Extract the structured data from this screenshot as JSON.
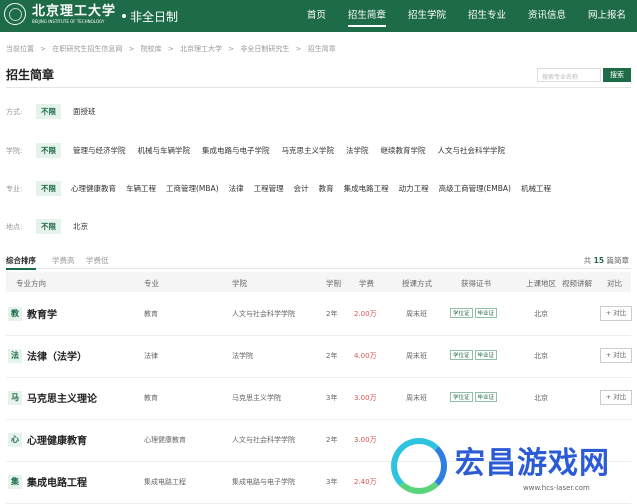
{
  "header": {
    "logo_cn": "北京理工大学",
    "logo_en": "BEIJING INSTITUTE OF TECHNOLOGY",
    "sub_title": "非全日制",
    "nav": [
      "首页",
      "招生简章",
      "招生学院",
      "招生专业",
      "资讯信息",
      "网上报名"
    ],
    "active_nav": "招生简章",
    "brand_color": "#1e6b47"
  },
  "breadcrumb": [
    "当前位置",
    ">",
    "在职研究生招生信息网",
    ">",
    "院校库",
    ">",
    "北京理工大学",
    ">",
    "非全日制研究生",
    ">",
    "招生简章"
  ],
  "page_title": "招生简章",
  "search": {
    "placeholder": "搜索专业名称",
    "button": "搜索"
  },
  "filters": {
    "mode": {
      "label": "方式:",
      "options": [
        "不限",
        "面授班"
      ]
    },
    "college": {
      "label": "学院:",
      "options": [
        "不限",
        "管理与经济学院",
        "机械与车辆学院",
        "集成电路与电子学院",
        "马克思主义学院",
        "法学院",
        "继续教育学院",
        "人文与社会科学学院"
      ]
    },
    "major": {
      "label": "专业:",
      "options": [
        "不限",
        "心理健康教育",
        "车辆工程",
        "工商管理(MBA)",
        "法律",
        "工程管理",
        "会计",
        "教育",
        "集成电路工程",
        "动力工程",
        "高级工商管理(EMBA)",
        "机械工程"
      ]
    },
    "location": {
      "label": "地点:",
      "options": [
        "不限",
        "北京"
      ]
    }
  },
  "sort": {
    "options": [
      "综合排序",
      "学费高",
      "学费低"
    ],
    "total_prefix": "共",
    "total": "15",
    "total_suffix": "篇简章"
  },
  "table": {
    "headers": [
      "专业方向",
      "专业",
      "学院",
      "学制",
      "学费",
      "授课方式",
      "获得证书",
      "上课地区",
      "视频讲解",
      "对比"
    ],
    "rows": [
      {
        "char": "教",
        "name": "教育学",
        "major": "教育",
        "college": "人文与社会科学学院",
        "years": "2年",
        "fee": "2.00万",
        "mode": "周末班",
        "certs": [
          "学位证",
          "毕业证"
        ],
        "location": "北京",
        "compare": "+ 对比"
      },
      {
        "char": "法",
        "name": "法律（法学）",
        "major": "法律",
        "college": "法学院",
        "years": "2年",
        "fee": "4.00万",
        "mode": "周末班",
        "certs": [
          "学位证",
          "毕业证"
        ],
        "location": "北京",
        "compare": "+ 对比"
      },
      {
        "char": "马",
        "name": "马克思主义理论",
        "major": "教育",
        "college": "马克思主义学院",
        "years": "3年",
        "fee": "3.00万",
        "mode": "周末班",
        "certs": [
          "学位证",
          "毕业证"
        ],
        "location": "北京",
        "compare": "+ 对比"
      },
      {
        "char": "心",
        "name": "心理健康教育",
        "major": "心理健康教育",
        "college": "人文与社会科学学院",
        "years": "2年",
        "fee": "3.00万",
        "mode": "",
        "certs": [],
        "location": "",
        "compare": ""
      },
      {
        "char": "集",
        "name": "集成电路工程",
        "major": "集成电路工程",
        "college": "集成电路与电子学院",
        "years": "3年",
        "fee": "2.40万",
        "mode": "",
        "certs": [],
        "location": "",
        "compare": ""
      }
    ]
  },
  "watermark": {
    "text": "宏昌游戏网",
    "url": "www.hcs-laser.com"
  }
}
